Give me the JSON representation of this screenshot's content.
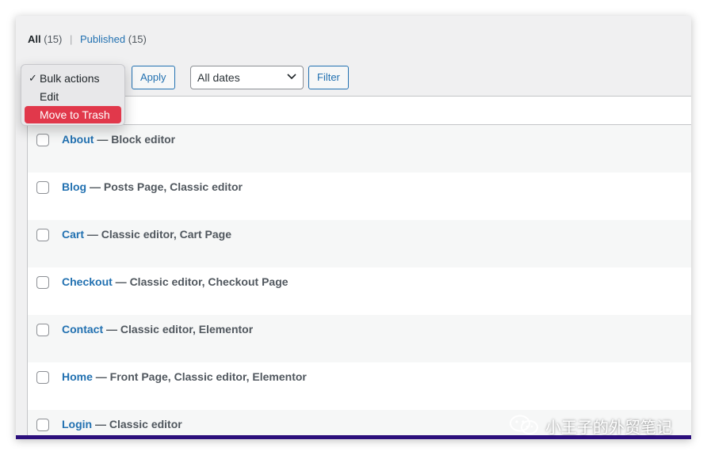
{
  "filters": {
    "all_label": "All",
    "all_count": "(15)",
    "separator": "|",
    "published_label": "Published",
    "published_count": "(15)"
  },
  "tablenav": {
    "apply_label": "Apply",
    "date_select_value": "All dates",
    "filter_label": "Filter"
  },
  "bulk_dropdown": {
    "options": [
      {
        "label": "Bulk actions",
        "checked": true
      },
      {
        "label": "Edit",
        "checked": false
      },
      {
        "label": "Move to Trash",
        "checked": false,
        "highlighted": true
      }
    ],
    "check_glyph": "✓",
    "highlight_color": "#e1384b"
  },
  "pages": [
    {
      "title": "About",
      "states": " — Block editor"
    },
    {
      "title": "Blog",
      "states": " — Posts Page, Classic editor"
    },
    {
      "title": "Cart",
      "states": " — Classic editor, Cart Page"
    },
    {
      "title": "Checkout",
      "states": " — Classic editor, Checkout Page"
    },
    {
      "title": "Contact",
      "states": " — Classic editor, Elementor"
    },
    {
      "title": "Home",
      "states": " — Front Page, Classic editor, Elementor"
    },
    {
      "title": "Login",
      "states": " — Classic editor"
    }
  ],
  "watermark": {
    "text": "小王子的外贸笔记",
    "icon": "wechat-icon"
  },
  "colors": {
    "link": "#2271b1",
    "accent_bar": "#2c0f7c"
  }
}
